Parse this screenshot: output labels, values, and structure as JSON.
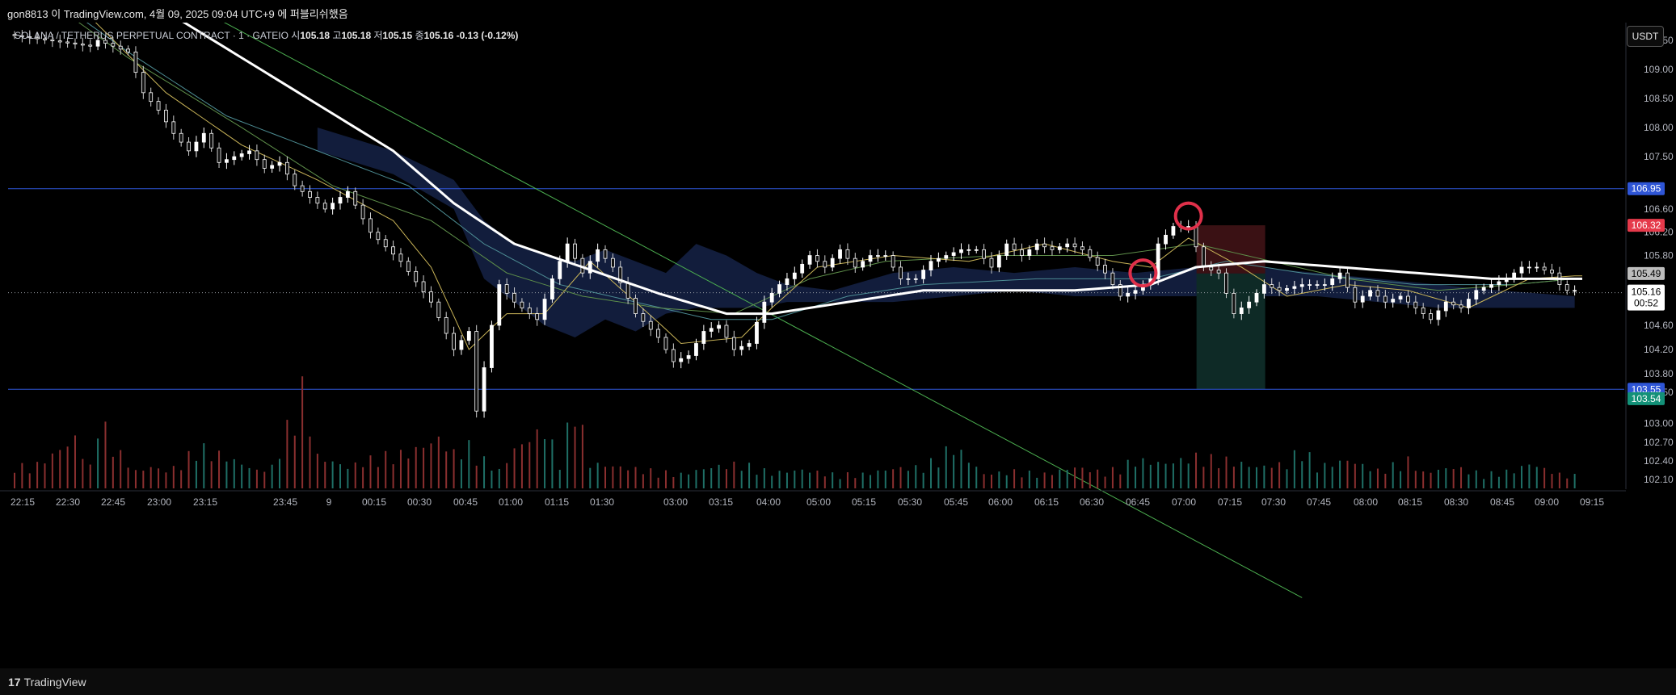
{
  "header": {
    "published_text": "gon8813 이 TradingView.com, 4월 09, 2025 09:04 UTC+9 에 퍼블리쉬했음"
  },
  "legend": {
    "symbol": "SOLANA / TETHERUS PERPETUAL CONTRACT · 1 · GATEIO",
    "open_label": "시",
    "open": "105.18",
    "high_label": "고",
    "high": "105.18",
    "low_label": "저",
    "low": "105.15",
    "close_label": "종",
    "close": "105.16",
    "change": "-0.13 (-0.12%)"
  },
  "currency_button": "USDT",
  "brand": "TradingView",
  "colors": {
    "background": "#000000",
    "up": "#26a69a",
    "down": "#ef5350",
    "ma_white": "#ffffff",
    "ma_yellow": "#c9b458",
    "ma_green": "#5e8f4a",
    "ma_teal": "#4d8d94",
    "cloud": "#142043",
    "hline": "#2e55d6",
    "trendline": "#4caf50",
    "circle": "#e0304a",
    "stop_zone": "#3a1114",
    "target_zone": "#0e2a26"
  },
  "chart_data": {
    "type": "candlestick",
    "interval": "1",
    "ylim": [
      102.0,
      109.7
    ],
    "y_ticks": [
      "109.50",
      "109.00",
      "108.50",
      "108.00",
      "107.50",
      "103.80",
      "103.50",
      "103.00",
      "102.70",
      "102.40",
      "102.10"
    ],
    "y_ticks_2": [
      "106.60",
      "106.20",
      "105.80",
      "104.60",
      "104.20"
    ],
    "x_ticks": [
      "22:15",
      "22:30",
      "22:45",
      "23:00",
      "23:15",
      "23:45",
      "9",
      "00:15",
      "00:30",
      "00:45",
      "01:00",
      "01:15",
      "01:30",
      "03:00",
      "03:15",
      "04:00",
      "05:00",
      "05:15",
      "05:30",
      "05:45",
      "06:00",
      "06:15",
      "06:30",
      "06:45",
      "07:00",
      "07:15",
      "07:30",
      "07:45",
      "08:00",
      "08:15",
      "08:30",
      "08:45",
      "09:00",
      "09:15"
    ],
    "price_path": [
      [
        0,
        109.6
      ],
      [
        11,
        109.4
      ],
      [
        12,
        109.5
      ],
      [
        16,
        109.3
      ],
      [
        18,
        108.6
      ],
      [
        20,
        108.3
      ],
      [
        22,
        107.9
      ],
      [
        24,
        107.6
      ],
      [
        26,
        107.9
      ],
      [
        28,
        107.4
      ],
      [
        30,
        107.5
      ],
      [
        32,
        107.6
      ],
      [
        34,
        107.3
      ],
      [
        36,
        107.4
      ],
      [
        38,
        107.0
      ],
      [
        40,
        106.8
      ],
      [
        42,
        106.6
      ],
      [
        45,
        106.9
      ],
      [
        48,
        106.2
      ],
      [
        52,
        105.7
      ],
      [
        56,
        105.0
      ],
      [
        59,
        104.2
      ],
      [
        61,
        104.5
      ],
      [
        62,
        103.2
      ],
      [
        65,
        105.3
      ],
      [
        67,
        105.0
      ],
      [
        70,
        104.7
      ],
      [
        72,
        105.4
      ],
      [
        74,
        106.0
      ],
      [
        76,
        105.5
      ],
      [
        78,
        105.9
      ],
      [
        80,
        105.6
      ],
      [
        83,
        104.8
      ],
      [
        86,
        104.4
      ],
      [
        88,
        104.0
      ],
      [
        90,
        104.1
      ],
      [
        92,
        104.5
      ],
      [
        94,
        104.6
      ],
      [
        96,
        104.2
      ],
      [
        98,
        104.3
      ],
      [
        100,
        105.0
      ],
      [
        102,
        105.3
      ],
      [
        104,
        105.5
      ],
      [
        106,
        105.8
      ],
      [
        108,
        105.6
      ],
      [
        110,
        105.9
      ],
      [
        112,
        105.6
      ],
      [
        114,
        105.8
      ],
      [
        116,
        105.8
      ],
      [
        118,
        105.4
      ],
      [
        120,
        105.4
      ],
      [
        122,
        105.7
      ],
      [
        124,
        105.8
      ],
      [
        126,
        105.9
      ],
      [
        128,
        105.9
      ],
      [
        130,
        105.6
      ],
      [
        132,
        106.0
      ],
      [
        134,
        105.8
      ],
      [
        136,
        106.0
      ],
      [
        138,
        105.9
      ],
      [
        140,
        106.0
      ],
      [
        142,
        105.9
      ],
      [
        145,
        105.5
      ],
      [
        147,
        105.1
      ],
      [
        149,
        105.2
      ],
      [
        151,
        105.4
      ],
      [
        152,
        106.0
      ],
      [
        154,
        106.3
      ],
      [
        156,
        106.3
      ],
      [
        158,
        105.6
      ],
      [
        160,
        105.5
      ],
      [
        162,
        104.8
      ],
      [
        164,
        105.0
      ],
      [
        166,
        105.3
      ],
      [
        168,
        105.2
      ],
      [
        171,
        105.3
      ],
      [
        174,
        105.3
      ],
      [
        176,
        105.5
      ],
      [
        178,
        105.0
      ],
      [
        180,
        105.2
      ],
      [
        182,
        105.0
      ],
      [
        184,
        105.1
      ],
      [
        186,
        104.9
      ],
      [
        188,
        104.7
      ],
      [
        190,
        105.0
      ],
      [
        192,
        104.9
      ],
      [
        194,
        105.2
      ],
      [
        196,
        105.3
      ],
      [
        198,
        105.4
      ],
      [
        200,
        105.6
      ],
      [
        202,
        105.6
      ],
      [
        204,
        105.5
      ],
      [
        205,
        105.3
      ],
      [
        206,
        105.2
      ]
    ],
    "ma_white": [
      [
        0,
        111.2
      ],
      [
        20,
        110.0
      ],
      [
        30,
        109.2
      ],
      [
        40,
        108.4
      ],
      [
        50,
        107.6
      ],
      [
        58,
        106.7
      ],
      [
        66,
        106.0
      ],
      [
        75,
        105.6
      ],
      [
        85,
        105.15
      ],
      [
        94,
        104.8
      ],
      [
        100,
        104.8
      ],
      [
        110,
        105.0
      ],
      [
        120,
        105.2
      ],
      [
        130,
        105.2
      ],
      [
        140,
        105.2
      ],
      [
        150,
        105.3
      ],
      [
        156,
        105.6
      ],
      [
        165,
        105.7
      ],
      [
        175,
        105.6
      ],
      [
        185,
        105.5
      ],
      [
        195,
        105.4
      ],
      [
        206,
        105.4
      ]
    ],
    "ma_yellow": [
      [
        0,
        110.8
      ],
      [
        10,
        109.9
      ],
      [
        20,
        108.6
      ],
      [
        30,
        107.7
      ],
      [
        40,
        107.1
      ],
      [
        50,
        106.4
      ],
      [
        55,
        105.6
      ],
      [
        60,
        104.2
      ],
      [
        65,
        104.8
      ],
      [
        70,
        104.8
      ],
      [
        76,
        105.7
      ],
      [
        82,
        105.0
      ],
      [
        88,
        104.3
      ],
      [
        96,
        104.4
      ],
      [
        100,
        104.9
      ],
      [
        106,
        105.6
      ],
      [
        116,
        105.8
      ],
      [
        126,
        105.7
      ],
      [
        136,
        106.0
      ],
      [
        145,
        105.7
      ],
      [
        150,
        105.6
      ],
      [
        155,
        106.1
      ],
      [
        162,
        105.6
      ],
      [
        168,
        105.1
      ],
      [
        176,
        105.3
      ],
      [
        184,
        105.2
      ],
      [
        192,
        104.9
      ],
      [
        200,
        105.4
      ],
      [
        206,
        105.45
      ]
    ],
    "ma_green": [
      [
        0,
        110.6
      ],
      [
        15,
        109.2
      ],
      [
        30,
        108.0
      ],
      [
        42,
        107.0
      ],
      [
        55,
        106.4
      ],
      [
        65,
        105.5
      ],
      [
        75,
        105.1
      ],
      [
        85,
        104.9
      ],
      [
        95,
        104.8
      ],
      [
        105,
        105.4
      ],
      [
        115,
        105.7
      ],
      [
        130,
        105.8
      ],
      [
        145,
        105.8
      ],
      [
        156,
        106.0
      ],
      [
        166,
        105.7
      ],
      [
        176,
        105.4
      ],
      [
        188,
        105.2
      ],
      [
        198,
        105.3
      ],
      [
        206,
        105.4
      ]
    ],
    "ma_teal": [
      [
        0,
        110.7
      ],
      [
        15,
        109.3
      ],
      [
        28,
        108.2
      ],
      [
        40,
        107.6
      ],
      [
        52,
        107.0
      ],
      [
        62,
        106.0
      ],
      [
        72,
        105.3
      ],
      [
        82,
        105.0
      ],
      [
        92,
        104.7
      ],
      [
        100,
        104.7
      ],
      [
        110,
        105.1
      ],
      [
        120,
        105.3
      ],
      [
        135,
        105.4
      ],
      [
        150,
        105.4
      ],
      [
        160,
        105.7
      ],
      [
        170,
        105.5
      ],
      [
        185,
        105.3
      ],
      [
        198,
        105.3
      ],
      [
        206,
        105.4
      ]
    ],
    "cloud_upper": [
      [
        40,
        108.0
      ],
      [
        50,
        107.6
      ],
      [
        58,
        107.1
      ],
      [
        62,
        106.4
      ],
      [
        66,
        106.0
      ],
      [
        70,
        105.8
      ],
      [
        74,
        105.7
      ],
      [
        78,
        105.9
      ],
      [
        82,
        105.7
      ],
      [
        86,
        105.5
      ],
      [
        90,
        106.0
      ],
      [
        94,
        105.8
      ],
      [
        98,
        105.5
      ],
      [
        102,
        105.3
      ],
      [
        108,
        105.2
      ],
      [
        116,
        105.5
      ],
      [
        124,
        105.6
      ],
      [
        132,
        105.5
      ],
      [
        140,
        105.6
      ],
      [
        148,
        105.5
      ],
      [
        156,
        105.6
      ],
      [
        164,
        105.6
      ],
      [
        172,
        105.5
      ],
      [
        180,
        105.4
      ],
      [
        188,
        105.3
      ],
      [
        196,
        105.2
      ],
      [
        206,
        105.1
      ]
    ],
    "cloud_lower": [
      [
        40,
        107.6
      ],
      [
        50,
        107.2
      ],
      [
        58,
        106.6
      ],
      [
        62,
        105.4
      ],
      [
        66,
        105.0
      ],
      [
        70,
        104.6
      ],
      [
        74,
        104.4
      ],
      [
        78,
        104.7
      ],
      [
        82,
        104.5
      ],
      [
        86,
        104.8
      ],
      [
        90,
        104.9
      ],
      [
        94,
        104.9
      ],
      [
        98,
        104.9
      ],
      [
        102,
        105.0
      ],
      [
        108,
        105.0
      ],
      [
        116,
        105.0
      ],
      [
        124,
        105.1
      ],
      [
        132,
        105.2
      ],
      [
        140,
        105.1
      ],
      [
        148,
        105.1
      ],
      [
        156,
        105.1
      ],
      [
        164,
        105.1
      ],
      [
        172,
        105.1
      ],
      [
        180,
        105.0
      ],
      [
        188,
        104.9
      ],
      [
        196,
        104.9
      ],
      [
        206,
        104.9
      ]
    ],
    "volume": [
      [
        0,
        35
      ],
      [
        2,
        28
      ],
      [
        4,
        40
      ],
      [
        6,
        55
      ],
      [
        8,
        70
      ],
      [
        10,
        30
      ],
      [
        11,
        100
      ],
      [
        14,
        48
      ],
      [
        16,
        24
      ],
      [
        18,
        30
      ],
      [
        20,
        25
      ],
      [
        22,
        33
      ],
      [
        24,
        60
      ],
      [
        28,
        44
      ],
      [
        32,
        25
      ],
      [
        34,
        30
      ],
      [
        38,
        140
      ],
      [
        40,
        45
      ],
      [
        44,
        30
      ],
      [
        48,
        45
      ],
      [
        52,
        50
      ],
      [
        56,
        70
      ],
      [
        58,
        50
      ],
      [
        60,
        60
      ],
      [
        62,
        40
      ],
      [
        64,
        25
      ],
      [
        66,
        55
      ],
      [
        70,
        85
      ],
      [
        72,
        38
      ],
      [
        74,
        125
      ],
      [
        76,
        35
      ],
      [
        80,
        30
      ],
      [
        84,
        25
      ],
      [
        88,
        20
      ],
      [
        92,
        30
      ],
      [
        96,
        35
      ],
      [
        100,
        22
      ],
      [
        104,
        26
      ],
      [
        108,
        20
      ],
      [
        112,
        20
      ],
      [
        116,
        28
      ],
      [
        120,
        30
      ],
      [
        124,
        60
      ],
      [
        128,
        20
      ],
      [
        132,
        24
      ],
      [
        136,
        20
      ],
      [
        140,
        30
      ],
      [
        144,
        22
      ],
      [
        148,
        40
      ],
      [
        152,
        35
      ],
      [
        156,
        45
      ],
      [
        160,
        40
      ],
      [
        164,
        30
      ],
      [
        168,
        35
      ],
      [
        170,
        60
      ],
      [
        172,
        30
      ],
      [
        176,
        40
      ],
      [
        180,
        25
      ],
      [
        184,
        40
      ],
      [
        186,
        22
      ],
      [
        190,
        30
      ],
      [
        194,
        20
      ],
      [
        198,
        25
      ],
      [
        200,
        35
      ],
      [
        204,
        20
      ],
      [
        206,
        18
      ]
    ],
    "trendline": [
      [
        12,
        110.9
      ],
      [
        170,
        100.2
      ]
    ],
    "hlines": [
      106.95,
      103.55
    ],
    "last_price_line": 105.16,
    "position": {
      "entry": 105.49,
      "stop": 106.32,
      "target": 103.55,
      "start_index": 155,
      "end_index": 163
    },
    "circles": [
      {
        "index": 149,
        "price": 105.5
      },
      {
        "index": 155,
        "price": 106.48
      }
    ],
    "price_labels": [
      {
        "value": 106.95,
        "text": "106.95",
        "bg": "#2e55d6",
        "fg": "#ffffff"
      },
      {
        "value": 106.32,
        "text": "106.32",
        "bg": "#e5394a",
        "fg": "#ffffff"
      },
      {
        "value": 105.49,
        "text": "105.49",
        "bg": "#bcbcbc",
        "fg": "#000000"
      },
      {
        "value": 103.55,
        "text": "103.55",
        "bg": "#2e55d6",
        "fg": "#ffffff"
      },
      {
        "value": 103.4,
        "text": "103.54",
        "bg": "#139178",
        "fg": "#ffffff"
      }
    ],
    "last_label": {
      "price": "105.16",
      "countdown": "00:52"
    }
  }
}
